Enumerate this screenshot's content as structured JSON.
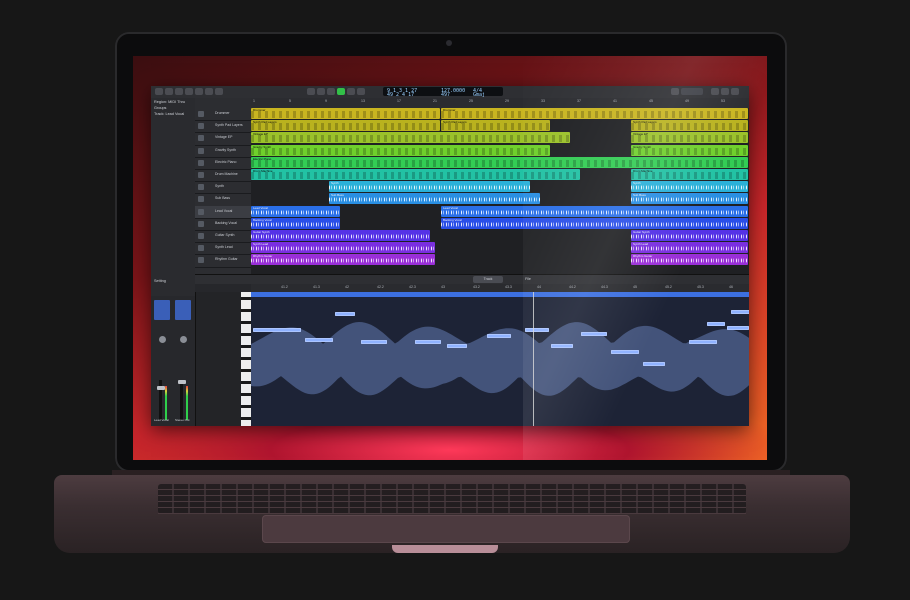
{
  "device": {
    "type": "laptop"
  },
  "app": {
    "lcd": {
      "position": "9 1 3 1 27",
      "position_sub": "49 2 4 17",
      "tempo": "127.0000",
      "tempo_sub": "497",
      "signature": "4/4",
      "key": "Gmaj"
    },
    "inspector": {
      "region_label": "Region: MIDI Thru",
      "groups_label": "Groups",
      "track_label": "Track: Lead Vocal",
      "setting_label": "Setting",
      "channel_a": "Lead Vocal",
      "channel_b": "Stereo Out"
    },
    "menu": {
      "edit": "Edit",
      "functions": "Functions",
      "view": "View"
    },
    "tracks": [
      {
        "name": "Drummer",
        "color": "#c9b520"
      },
      {
        "name": "Synth Pad Layers",
        "color": "#b9b21e"
      },
      {
        "name": "Vintage EP",
        "color": "#9bc22a"
      },
      {
        "name": "Gravity Synth",
        "color": "#6fd02c"
      },
      {
        "name": "Electric Piano",
        "color": "#33cc54"
      },
      {
        "name": "Drum Machine",
        "color": "#22c2a4"
      },
      {
        "name": "Synth",
        "color": "#2bb1d9"
      },
      {
        "name": "Sub Bass",
        "color": "#2a8fe3"
      },
      {
        "name": "Lead Vocal",
        "color": "#2a6fe8"
      },
      {
        "name": "Backing Vocal",
        "color": "#2a4fe8"
      },
      {
        "name": "Guitar Synth",
        "color": "#5432e6"
      },
      {
        "name": "Synth Lead",
        "color": "#7a2fe0"
      },
      {
        "name": "Rhythm Guitar",
        "color": "#9a2fd8"
      }
    ],
    "ruler_marks": [
      "1",
      "5",
      "9",
      "13",
      "17",
      "21",
      "25",
      "29",
      "33",
      "37",
      "41",
      "45",
      "49",
      "53"
    ],
    "editor": {
      "tab_track": "Track",
      "tab_file": "File",
      "ruler_marks": [
        "41.2",
        "41.3",
        "42",
        "42.2",
        "42.3",
        "43",
        "43.2",
        "43.3",
        "44",
        "44.2",
        "44.3",
        "45",
        "45.2",
        "45.3",
        "46"
      ]
    },
    "colors": {
      "accent": "#3c6fe0",
      "play": "#32c048",
      "app_bg": "#232427"
    }
  }
}
